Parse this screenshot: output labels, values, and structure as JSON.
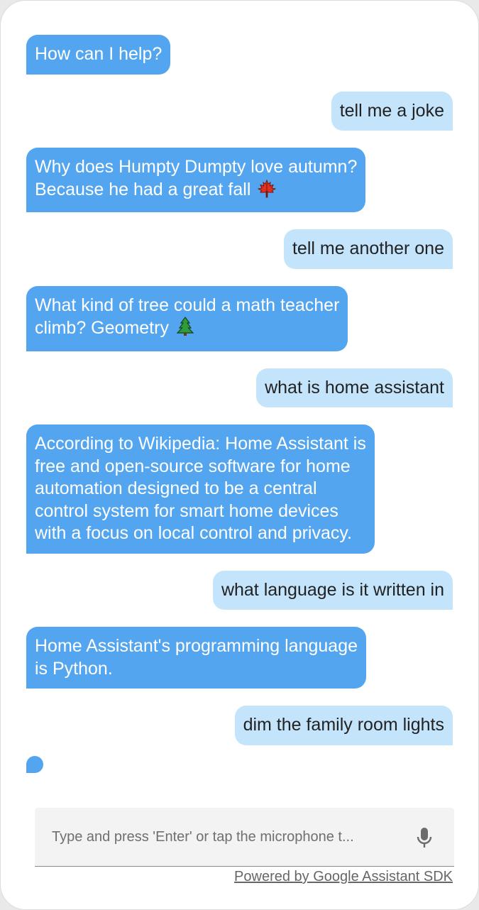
{
  "conversation": [
    {
      "from": "assistant",
      "lines": [
        "How can I help?"
      ]
    },
    {
      "from": "user",
      "lines": [
        "tell me a joke"
      ]
    },
    {
      "from": "assistant",
      "lines": [
        "Why does Humpty Dumpty love autumn?",
        "Because he had a great fall"
      ],
      "emoji": "maple-leaf-icon"
    },
    {
      "from": "user",
      "lines": [
        "tell me another one"
      ]
    },
    {
      "from": "assistant",
      "lines": [
        "What kind of tree could a math teacher",
        "climb? Geometry"
      ],
      "emoji": "evergreen-tree-icon"
    },
    {
      "from": "user",
      "lines": [
        "what is home assistant"
      ]
    },
    {
      "from": "assistant",
      "lines": [
        "According to Wikipedia: Home Assistant is",
        "free and open-source software for home",
        "automation designed to be a central",
        "control system for smart home devices",
        "with a focus on local control and privacy."
      ]
    },
    {
      "from": "user",
      "lines": [
        "what language is it written in"
      ]
    },
    {
      "from": "assistant",
      "lines": [
        "Home Assistant's programming language",
        "is Python."
      ]
    },
    {
      "from": "user",
      "lines": [
        "dim the family room lights"
      ]
    }
  ],
  "input": {
    "placeholder": "Type and press 'Enter' or tap the microphone t...",
    "value": ""
  },
  "icons": {
    "microphone": "microphone-icon",
    "typing_indicator": "typing-indicator"
  },
  "footer": {
    "powered_by": "Powered by Google Assistant SDK"
  },
  "colors": {
    "assistant_bubble": "#54a5f0",
    "user_bubble": "#c4e4fb",
    "input_background": "#f3f3f3"
  }
}
